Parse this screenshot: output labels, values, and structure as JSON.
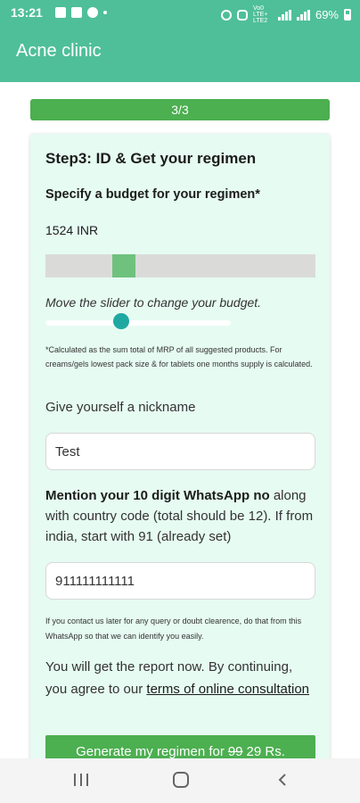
{
  "status_bar": {
    "time": "13:21",
    "network": "Vo0 LTE+ LTE2",
    "battery": "69%"
  },
  "app_bar": {
    "title": "Acne clinic"
  },
  "progress": {
    "label": "3/3"
  },
  "form": {
    "step_title": "Step3: ID & Get your regimen",
    "budget_label": "Specify a budget for your regimen*",
    "budget_value": "1524 INR",
    "budget_level_fraction": 0.27,
    "slider_hint": "Move the slider to change your budget.",
    "footnote": "*Calculated as the sum total of MRP of all suggested products. For creams/gels lowest pack size & for tablets one months supply is calculated.",
    "nickname_label": "Give yourself a nickname",
    "nickname_value": "Test",
    "whatsapp_label_bold": "Mention your 10 digit WhatsApp no",
    "whatsapp_label_rest": " along with country code (total should be 12). If from india, start with 91 (already set)",
    "whatsapp_value": "911111111111",
    "contact_note": "If you contact us later for any query or doubt clearence, do that from this WhatsApp so that we can identify you easily.",
    "report_text": "You will get the report now. By continuing, you agree to our ",
    "terms_link": "terms of online consultation",
    "cta_prefix": "Generate my regimen for",
    "cta_old_price": "99",
    "cta_new_price": "29 Rs."
  },
  "colors": {
    "header": "#4fbf99",
    "progress": "#4caf50",
    "card_bg": "#e6fbf2",
    "slider_thumb": "#1fa8a2",
    "budget_fill": "#6fc27d"
  }
}
